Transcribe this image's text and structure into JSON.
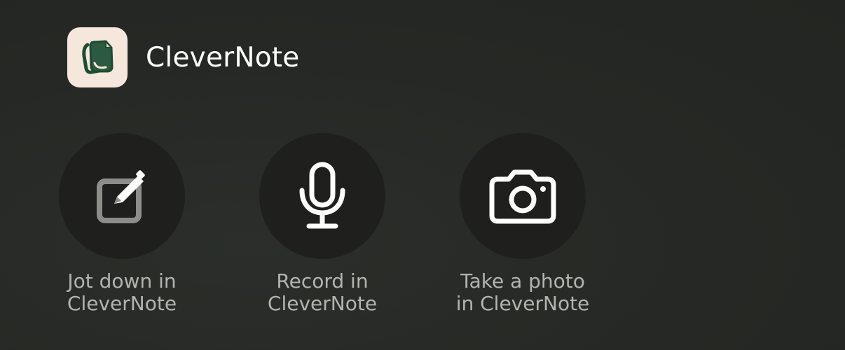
{
  "app": {
    "name": "CleverNote",
    "icon": "clevernote-logo-icon",
    "icon_bg_color": "#f6e7dc",
    "icon_fg_color": "#1f4a33"
  },
  "actions": [
    {
      "label": "Jot down in\nCleverNote",
      "icon": "compose-note-icon"
    },
    {
      "label": "Record in\nCleverNote",
      "icon": "microphone-icon"
    },
    {
      "label": "Take a photo\nin CleverNote",
      "icon": "camera-icon"
    }
  ],
  "colors": {
    "background": "#262825",
    "action_circle": "#1f201e",
    "label_text": "#b3b3b0",
    "title_text": "#ffffff"
  }
}
